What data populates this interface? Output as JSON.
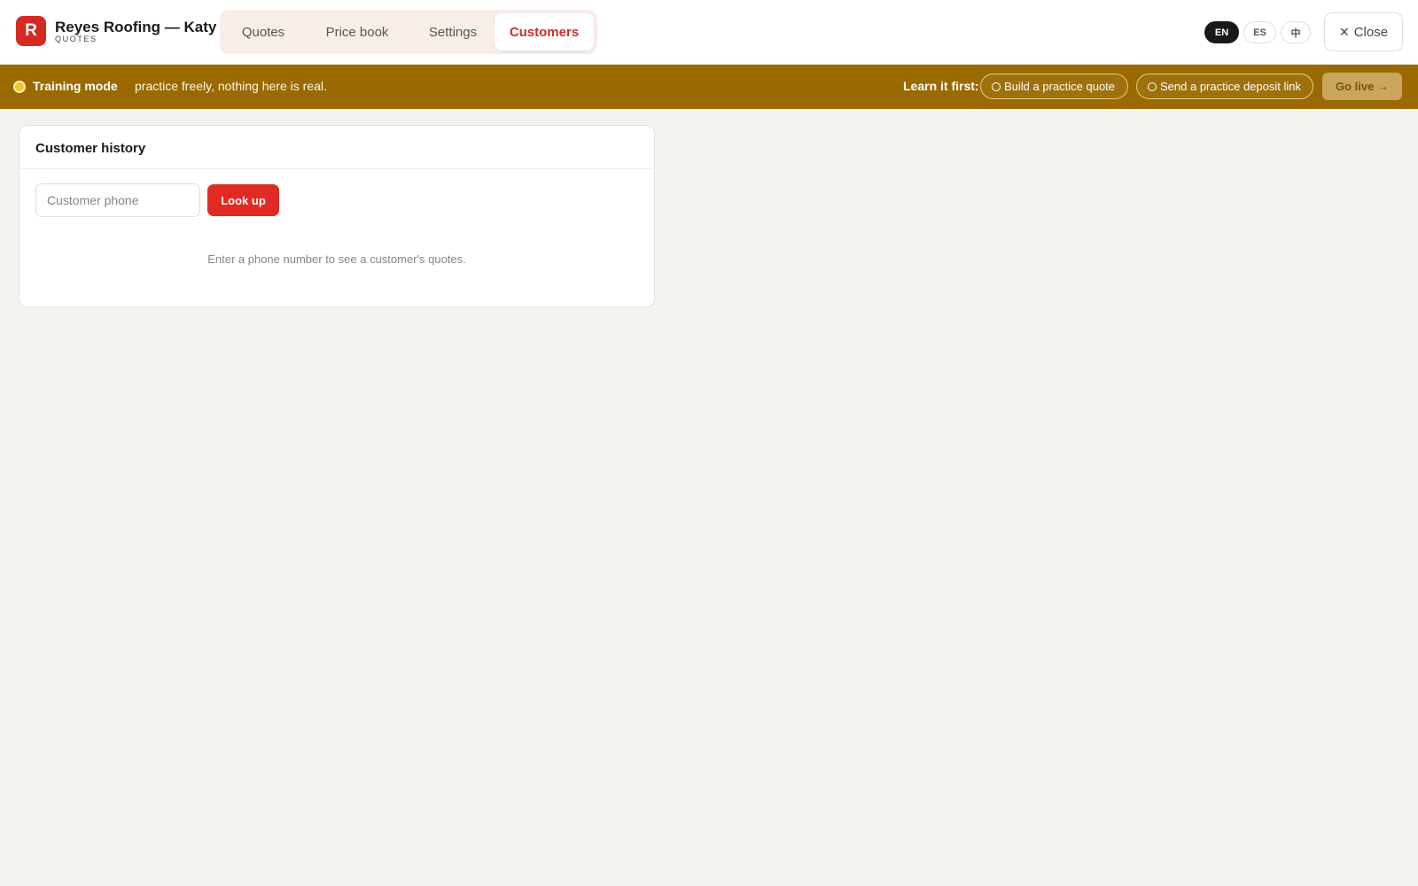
{
  "app": {
    "logo_letter": "R",
    "title": "Reyes Roofing — Katy",
    "subtitle": "QUOTES"
  },
  "tabs": [
    {
      "label": "Quotes",
      "active": false
    },
    {
      "label": "Price book",
      "active": false
    },
    {
      "label": "Settings",
      "active": false
    },
    {
      "label": "Customers",
      "active": true
    }
  ],
  "languages": [
    {
      "code": "EN",
      "active": true
    },
    {
      "code": "ES",
      "active": false
    },
    {
      "code": "中",
      "active": false
    }
  ],
  "close": {
    "icon": "close-icon",
    "label": "Close"
  },
  "training": {
    "title": "Training mode",
    "text": "practice freely, nothing here is real.",
    "learn_label": "Learn it first:",
    "tasks": [
      {
        "label": "Build a practice quote",
        "done": false
      },
      {
        "label": "Send a practice deposit link",
        "done": false
      }
    ],
    "go_live": "Go live →"
  },
  "customer_history": {
    "title": "Customer history",
    "phone_value": "",
    "phone_placeholder": "Customer phone",
    "lookup_label": "Look up",
    "empty_message": "Enter a phone number to see a customer's quotes."
  },
  "colors": {
    "brand_red": "#d42a22",
    "training_bar": "#9a6a00",
    "background": "#f4f2ee"
  }
}
